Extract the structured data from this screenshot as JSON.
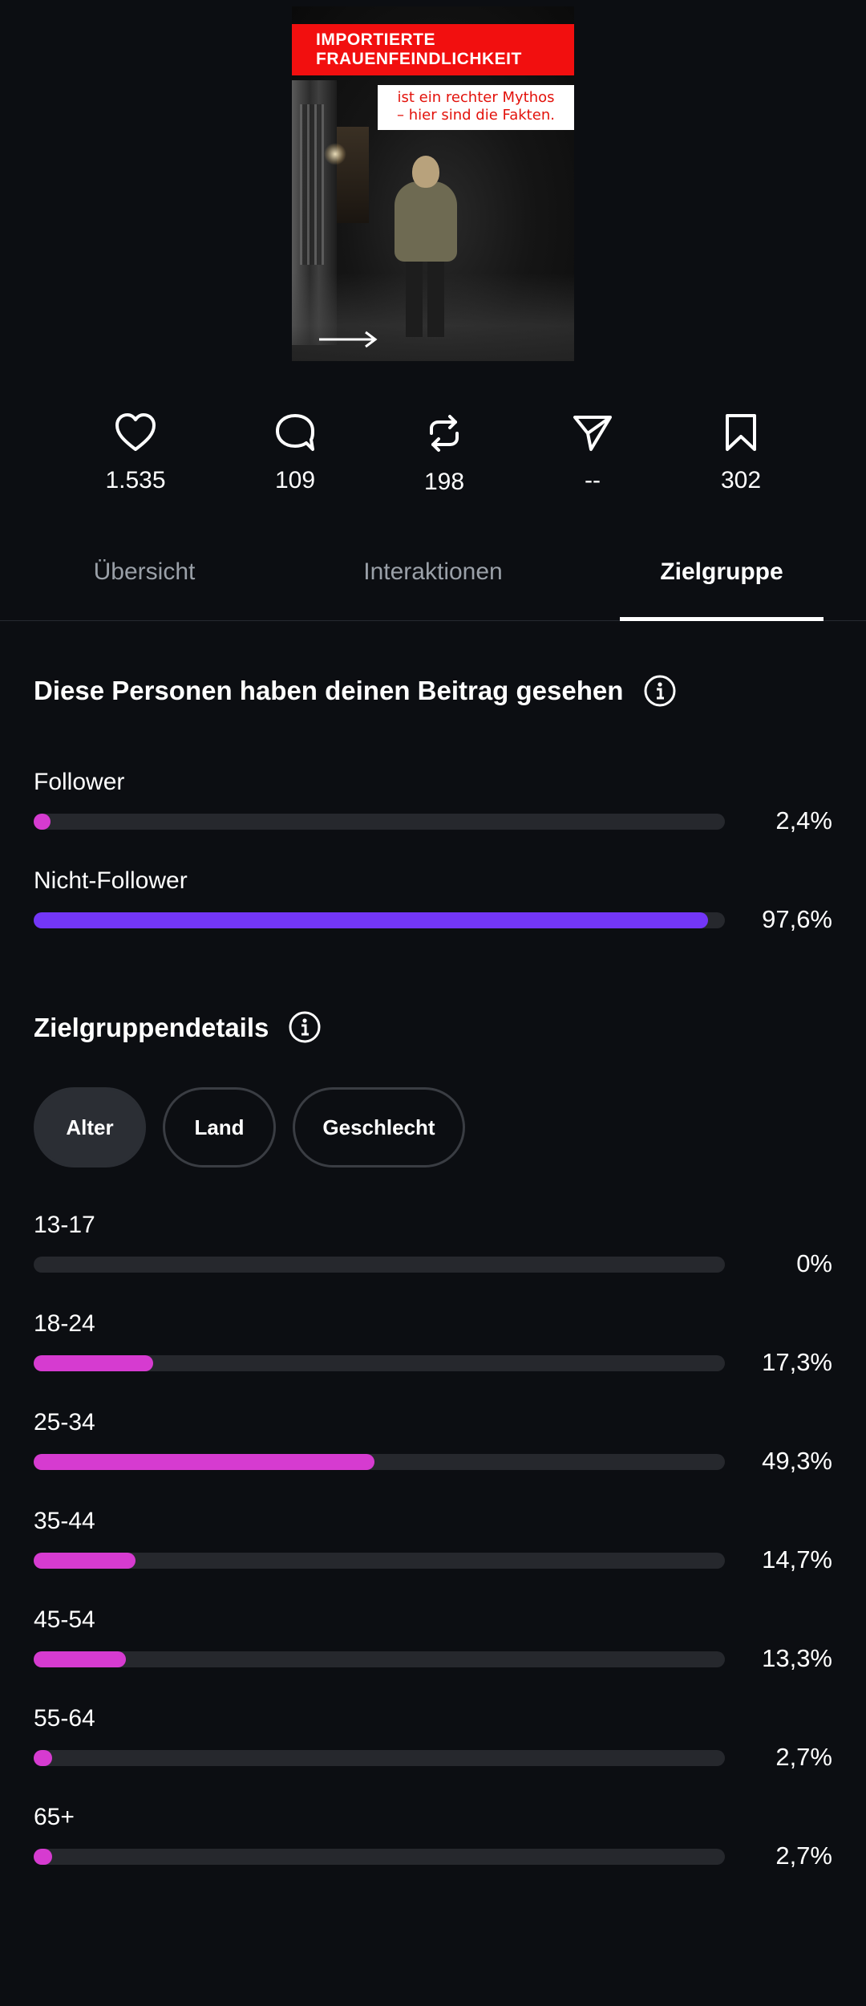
{
  "post": {
    "headline_line1": "IMPORTIERTE",
    "headline_line2": "FRAUENFEINDLICHKEIT",
    "subline_line1": "ist ein rechter Mythos",
    "subline_line2": "– hier sind die Fakten."
  },
  "stats": [
    {
      "icon": "heart-icon",
      "value": "1.535"
    },
    {
      "icon": "comment-icon",
      "value": "109"
    },
    {
      "icon": "repost-icon",
      "value": "198"
    },
    {
      "icon": "share-icon",
      "value": "--"
    },
    {
      "icon": "bookmark-icon",
      "value": "302"
    }
  ],
  "tabs": [
    {
      "label": "Übersicht",
      "active": false
    },
    {
      "label": "Interaktionen",
      "active": false
    },
    {
      "label": "Zielgruppe",
      "active": true
    }
  ],
  "viewers": {
    "title": "Diese Personen haben deinen Beitrag gesehen",
    "rows": [
      {
        "label": "Follower",
        "value": "2,4%",
        "percent": 2.4,
        "color": "#d63bd0"
      },
      {
        "label": "Nicht-Follower",
        "value": "97,6%",
        "percent": 97.6,
        "color": "#7336f7"
      }
    ]
  },
  "audience": {
    "title": "Zielgruppendetails",
    "filters": [
      {
        "label": "Alter",
        "active": true
      },
      {
        "label": "Land",
        "active": false
      },
      {
        "label": "Geschlecht",
        "active": false
      }
    ],
    "accent_color": "#d63bd0",
    "rows": [
      {
        "label": "13-17",
        "value": "0%",
        "percent": 0
      },
      {
        "label": "18-24",
        "value": "17,3%",
        "percent": 17.3
      },
      {
        "label": "25-34",
        "value": "49,3%",
        "percent": 49.3
      },
      {
        "label": "35-44",
        "value": "14,7%",
        "percent": 14.7
      },
      {
        "label": "45-54",
        "value": "13,3%",
        "percent": 13.3
      },
      {
        "label": "55-64",
        "value": "2,7%",
        "percent": 2.7
      },
      {
        "label": "65+",
        "value": "2,7%",
        "percent": 2.7
      }
    ]
  }
}
